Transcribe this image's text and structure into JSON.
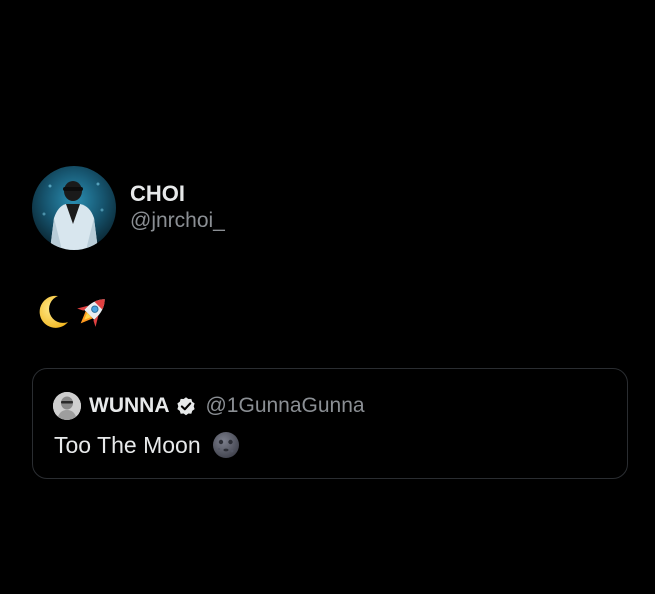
{
  "tweet": {
    "author": {
      "display_name": "CHOI",
      "handle": "@jnrchoi_"
    },
    "emojis": [
      "crescent-moon-emoji",
      "rocket-emoji"
    ]
  },
  "quoted_tweet": {
    "author": {
      "display_name": "WUNNA",
      "handle": "@1GunnaGunna",
      "verified": true
    },
    "text": "Too The Moon",
    "emoji": "new-moon-face-emoji"
  },
  "colors": {
    "background": "#000000",
    "primary_text": "#e7e9ea",
    "secondary_text": "#8b8f94",
    "card_border": "#2a2d31"
  }
}
